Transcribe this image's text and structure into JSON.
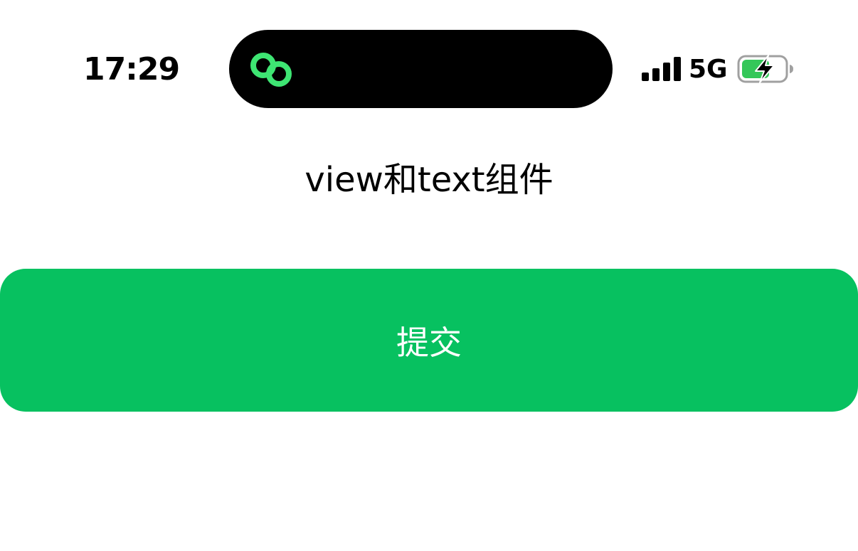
{
  "status_bar": {
    "time": "17:29",
    "network": "5G",
    "signal_icon": "cellular-signal-icon",
    "battery_icon": "battery-charging-icon",
    "island_icon": "linked-rings-icon",
    "island_icon_color": "#3ee573",
    "battery_fill_color": "#34c759"
  },
  "main": {
    "title": "view和text组件",
    "submit_button_label": "提交",
    "submit_button_color": "#07c160"
  }
}
